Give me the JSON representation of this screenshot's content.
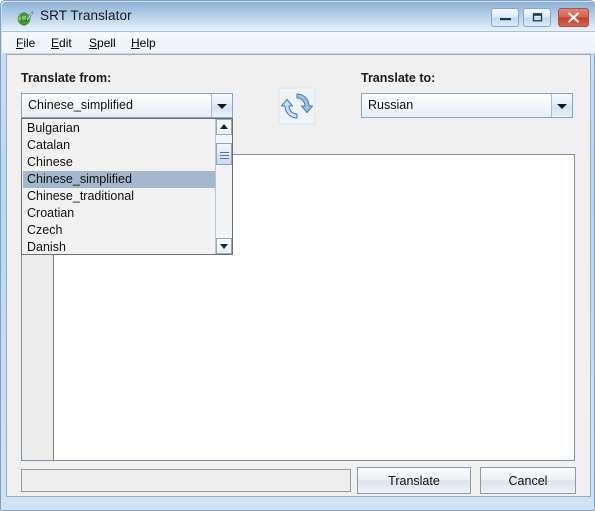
{
  "window": {
    "title": "SRT Translator",
    "app_icon": "globe-pen-icon",
    "controls": {
      "minimize": "minimize-icon",
      "maximize": "maximize-icon",
      "close": "close-icon",
      "close_glyph": "✕"
    }
  },
  "menubar": {
    "items": [
      {
        "label": "File",
        "mnemonic": "F",
        "rest": "ile"
      },
      {
        "label": "Edit",
        "mnemonic": "E",
        "rest": "dit"
      },
      {
        "label": "Spell",
        "mnemonic": "S",
        "rest": "pell"
      },
      {
        "label": "Help",
        "mnemonic": "H",
        "rest": "elp"
      }
    ]
  },
  "source": {
    "label": "Translate from:",
    "selected": "Chinese_simplified",
    "dropdown_open": true,
    "options": [
      "Bulgarian",
      "Catalan",
      "Chinese",
      "Chinese_simplified",
      "Chinese_traditional",
      "Croatian",
      "Czech",
      "Danish"
    ],
    "selected_index": 3
  },
  "target": {
    "label": "Translate to:",
    "selected": "Russian"
  },
  "swap": {
    "icon": "swap-languages-icon"
  },
  "editor": {
    "content": "",
    "gutter_content": ""
  },
  "footer": {
    "progress_value": "",
    "translate_label": "Translate",
    "cancel_label": "Cancel"
  },
  "colors": {
    "titlebar_top": "#8db0d2",
    "titlebar_bottom": "#e8f1fa",
    "frame": "#bcd6ee",
    "selection": "#a3b8cc",
    "close_button": "#bf3f2c",
    "panel_bg": "#f0f0f0",
    "editor_bg": "#ffffff"
  }
}
